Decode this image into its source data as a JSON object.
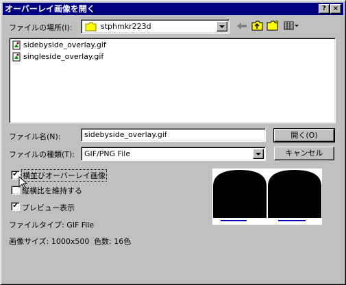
{
  "window": {
    "title": "オーバーレイ画像を開く",
    "help_button": "?",
    "close_button": "×"
  },
  "location": {
    "label": "ファイルの場所(I):",
    "value": "stphmkr223d"
  },
  "files": [
    {
      "name": "sidebyside_overlay.gif",
      "icon": "gif-file-icon"
    },
    {
      "name": "singleside_overlay.gif",
      "icon": "gif-file-icon"
    }
  ],
  "filename": {
    "label": "ファイル名(N):",
    "value": "sidebyside_overlay.gif"
  },
  "filetype": {
    "label": "ファイルの種類(T):",
    "value": "GIF/PNG File"
  },
  "buttons": {
    "open": "開く(O)",
    "cancel": "キャンセル"
  },
  "options": {
    "side_by_side": {
      "label": "横並びオーバーレイ画像",
      "checked": true
    },
    "keep_aspect": {
      "label": "縦横比を維持する",
      "checked": false
    },
    "preview": {
      "label": "プレビュー表示",
      "checked": true
    }
  },
  "info": {
    "file_type": "ファイルタイプ: GIF File",
    "image_size": "画像サイズ: 1000x500",
    "colors": "色数: 16色"
  },
  "colors": {
    "titlebar": "#000080",
    "face": "#c0c0c0",
    "folder": "#ffff00"
  }
}
